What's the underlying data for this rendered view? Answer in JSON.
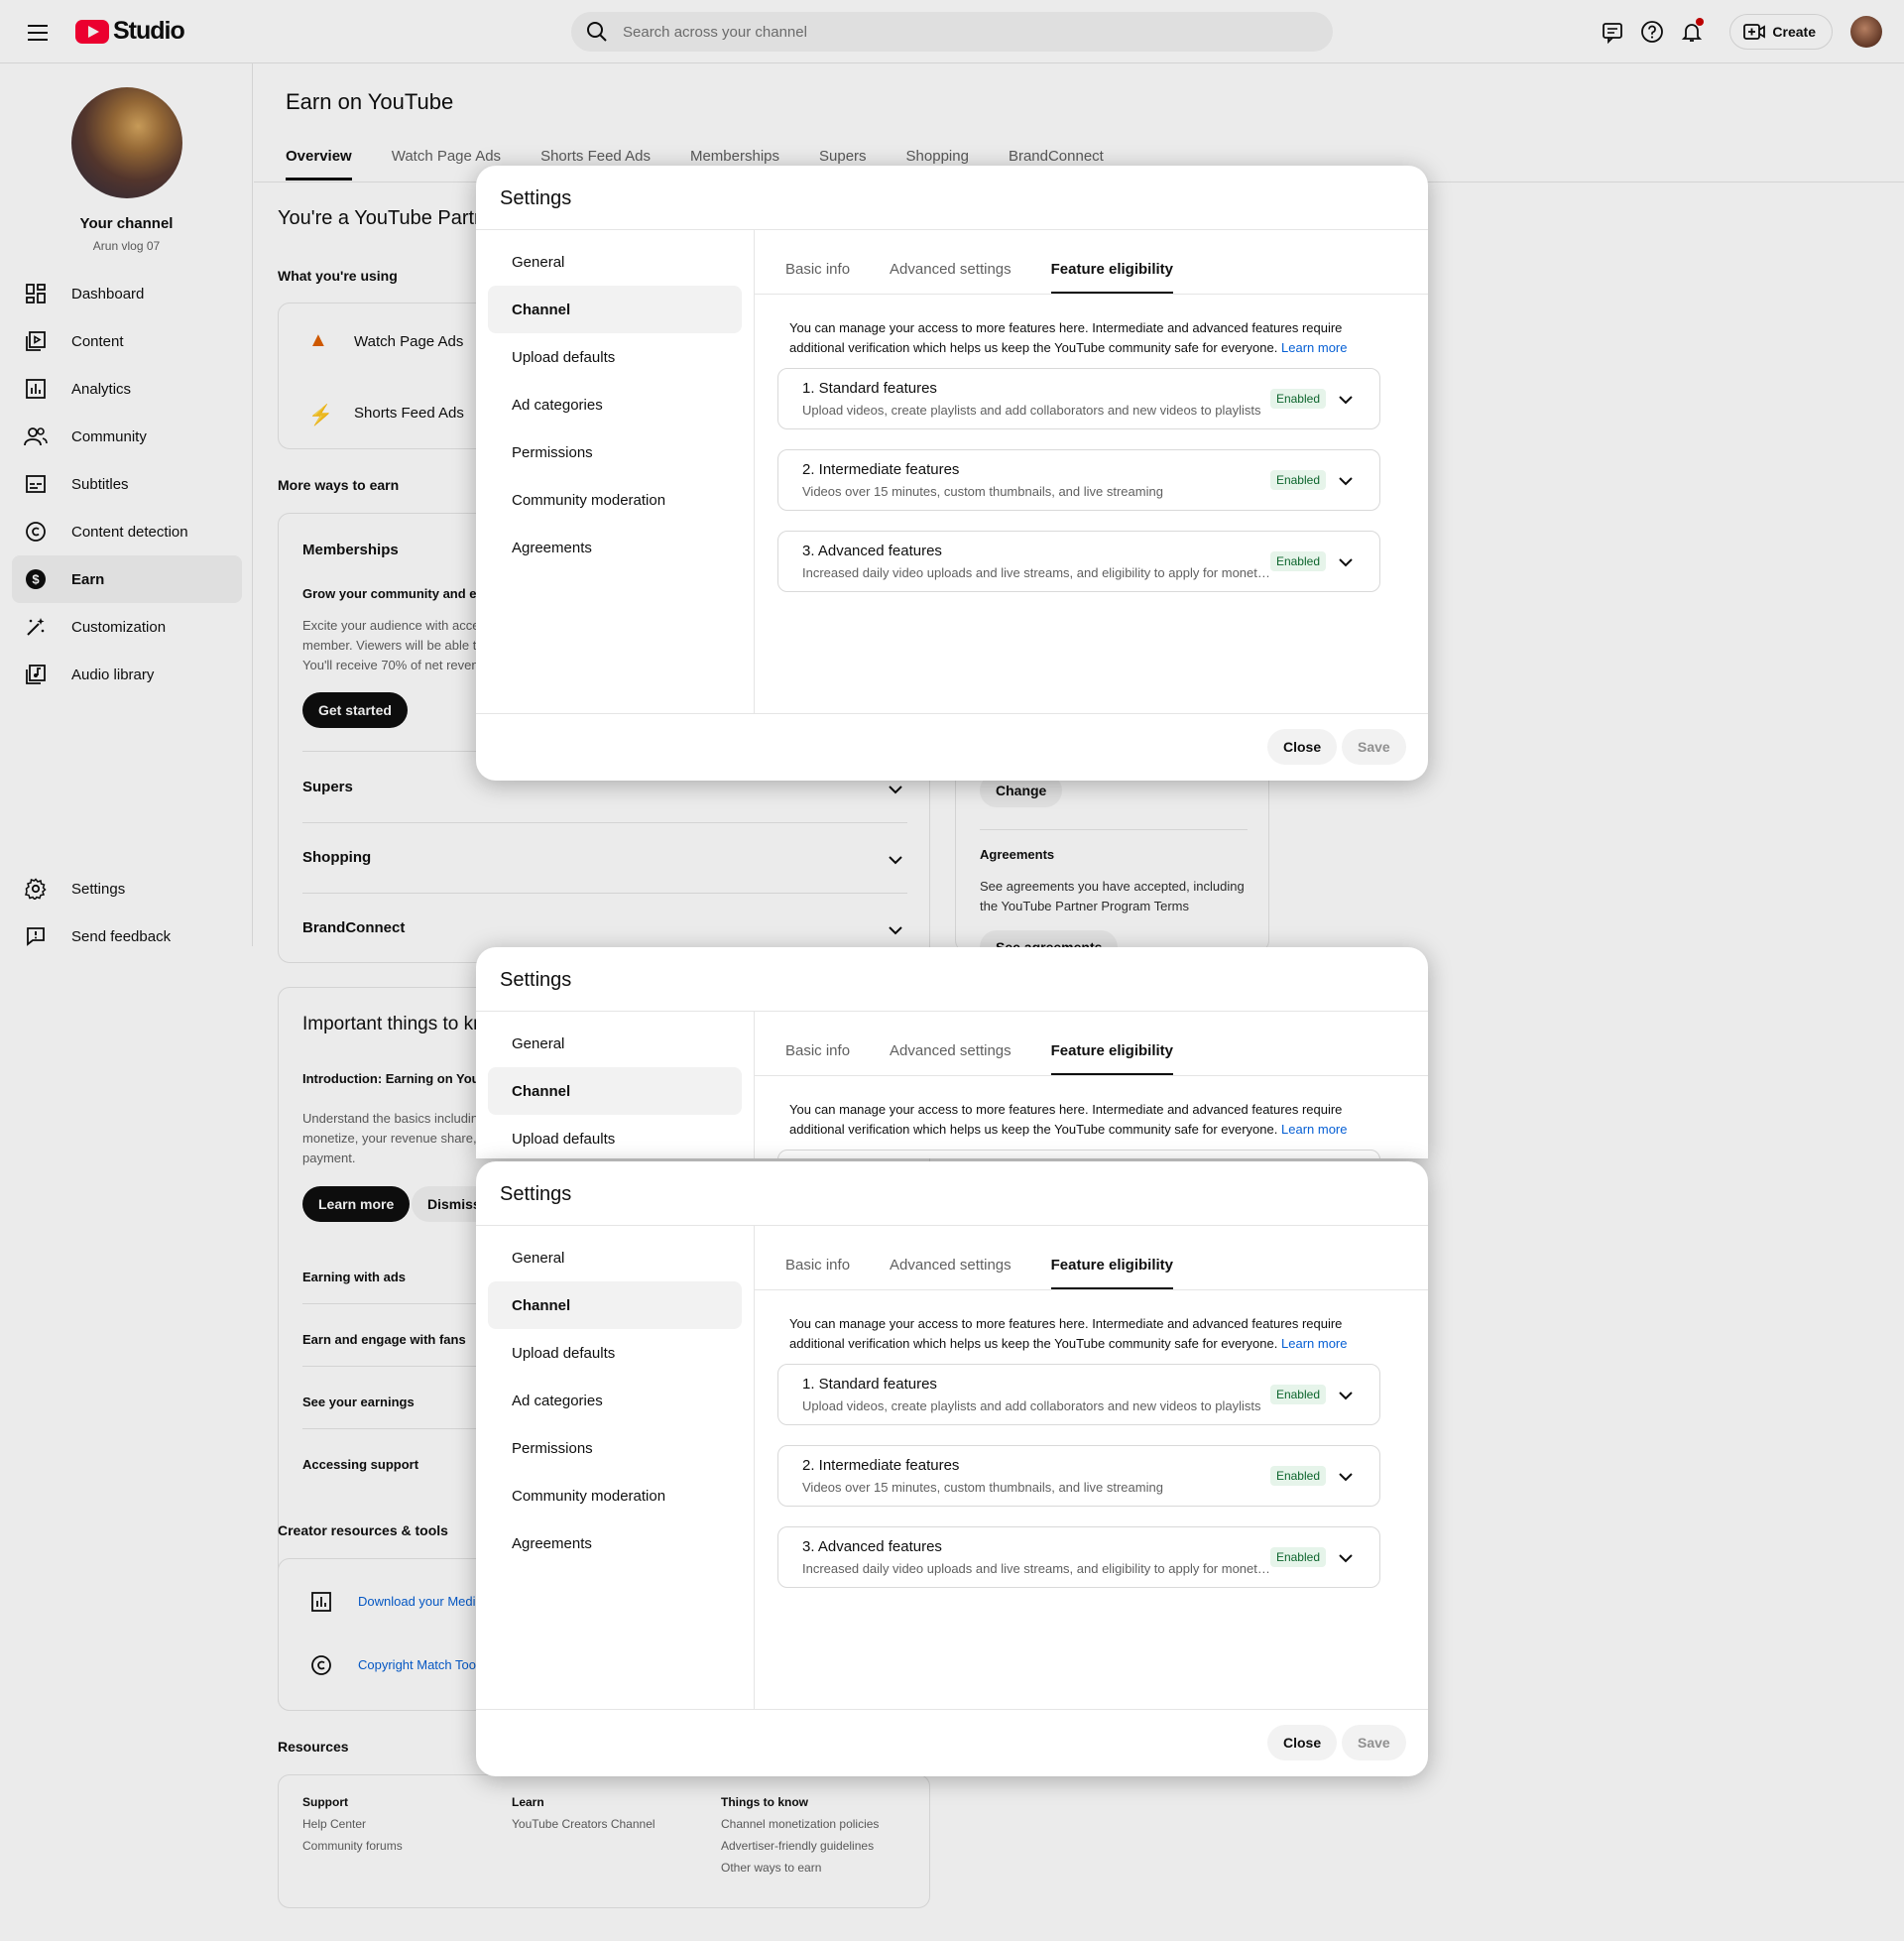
{
  "header": {
    "app_name": "Studio",
    "search_placeholder": "Search across your channel",
    "create_label": "Create"
  },
  "sidebar": {
    "channel_name": "Your channel",
    "channel_handle": "Arun vlog 07",
    "items": [
      {
        "label": "Dashboard",
        "icon": "dashboard-icon"
      },
      {
        "label": "Content",
        "icon": "content-icon"
      },
      {
        "label": "Analytics",
        "icon": "analytics-icon"
      },
      {
        "label": "Community",
        "icon": "community-icon"
      },
      {
        "label": "Subtitles",
        "icon": "subtitles-icon"
      },
      {
        "label": "Content detection",
        "icon": "copyright-icon"
      },
      {
        "label": "Earn",
        "icon": "dollar-icon"
      },
      {
        "label": "Customization",
        "icon": "magic-wand-icon"
      },
      {
        "label": "Audio library",
        "icon": "audio-library-icon"
      }
    ],
    "settings_label": "Settings",
    "feedback_label": "Send feedback"
  },
  "main": {
    "title": "Earn on YouTube",
    "tabs": [
      "Overview",
      "Watch Page Ads",
      "Shorts Feed Ads",
      "Memberships",
      "Supers",
      "Shopping",
      "BrandConnect"
    ],
    "partner_heading": "You're a YouTube Partr",
    "using_heading": "What you're using",
    "using_items": [
      "Watch Page Ads",
      "Shorts Feed Ads"
    ],
    "more_ways_heading": "More ways to earn",
    "memberships": {
      "title": "Memberships",
      "subtitle": "Grow your community and ear",
      "desc_lines": [
        "Excite your audience with acce",
        "member. Viewers will be able t",
        "You'll receive 70% of net reven"
      ],
      "cta": "Get started"
    },
    "collapsed_sections": [
      "Supers",
      "Shopping",
      "BrandConnect"
    ],
    "right_card": {
      "change_label": "Change",
      "agreements_title": "Agreements",
      "agreements_desc_1": "See agreements you have accepted, including",
      "agreements_desc_2": "the YouTube Partner Program Terms",
      "see_agreements": "See agreements"
    },
    "important": {
      "title": "Important things to kr",
      "intro_title": "Introduction: Earning on YouTu",
      "intro_lines": [
        "Understand the basics includin",
        "monetize, your revenue share,",
        "payment."
      ],
      "learn_more": "Learn more",
      "dismiss": "Dismiss",
      "topics": [
        "Earning with ads",
        "Earn and engage with fans",
        "See your earnings",
        "Accessing support"
      ]
    },
    "creator_resources": {
      "title": "Creator resources & tools",
      "items": [
        "Download your Medi",
        "Copyright Match Too"
      ]
    },
    "resources": {
      "title": "Resources",
      "columns": [
        {
          "heading": "Support",
          "links": [
            "Help Center",
            "Community forums"
          ]
        },
        {
          "heading": "Learn",
          "links": [
            "YouTube Creators Channel"
          ]
        },
        {
          "heading": "Things to know",
          "links": [
            "Channel monetization policies",
            "Advertiser-friendly guidelines",
            "Other ways to earn"
          ]
        }
      ]
    }
  },
  "dialog": {
    "title": "Settings",
    "nav": [
      "General",
      "Channel",
      "Upload defaults",
      "Ad categories",
      "Permissions",
      "Community moderation",
      "Agreements"
    ],
    "tabs": [
      "Basic info",
      "Advanced settings",
      "Feature eligibility"
    ],
    "description": "You can manage your access to more features here. Intermediate and advanced features require additional verification which helps us keep the YouTube community safe for everyone.",
    "learn_more": "Learn more",
    "features": [
      {
        "title": "1. Standard features",
        "subtitle": "Upload videos, create playlists and add collaborators and new videos to playlists",
        "status": "Enabled"
      },
      {
        "title": "2. Intermediate features",
        "subtitle": "Videos over 15 minutes, custom thumbnails, and live streaming",
        "status": "Enabled"
      },
      {
        "title": "3. Advanced features",
        "subtitle": "Increased daily video uploads and live streams, and eligibility to apply for monetization",
        "status": "Enabled"
      }
    ],
    "close_label": "Close",
    "save_label": "Save"
  }
}
